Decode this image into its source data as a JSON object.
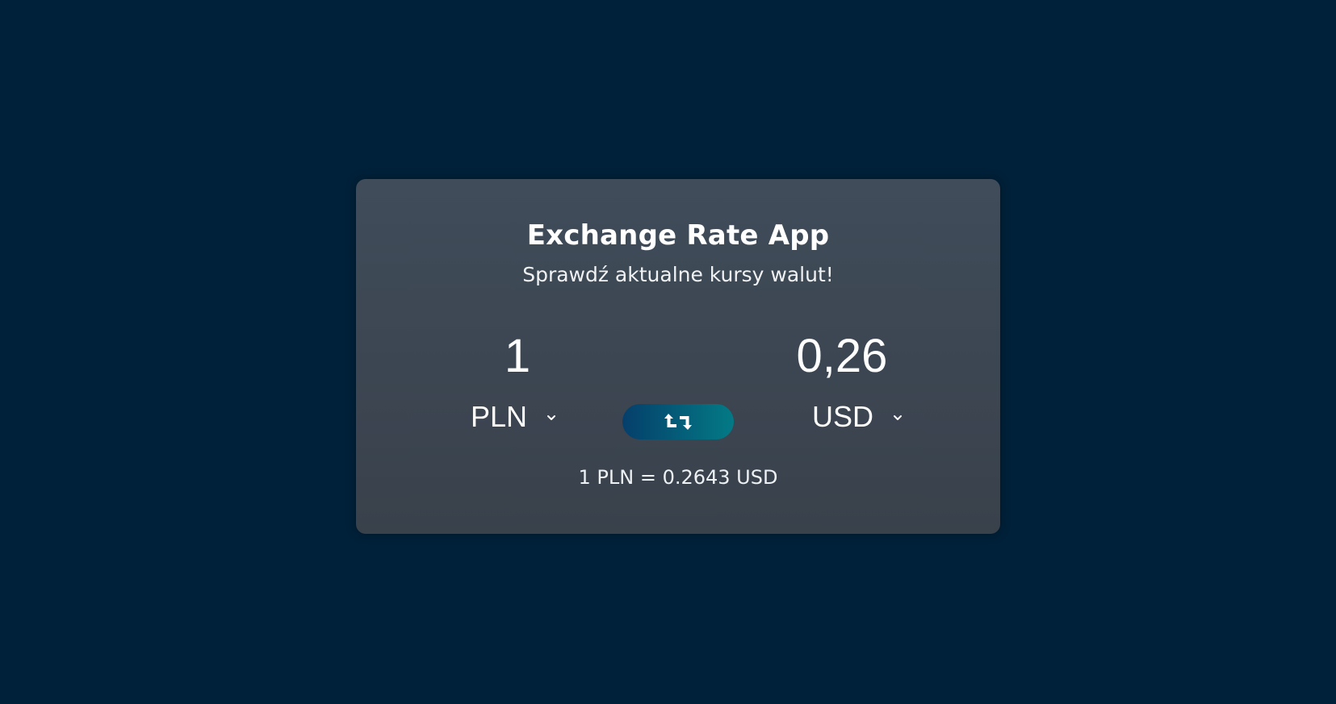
{
  "app": {
    "title": "Exchange Rate App",
    "subtitle": "Sprawdź aktualne kursy walut!"
  },
  "converter": {
    "from": {
      "amount": "1",
      "currency": "PLN"
    },
    "to": {
      "amount": "0,26",
      "currency": "USD"
    },
    "swap_icon": "swap-arrows-icon",
    "rate_text": "1 PLN = 0.2643 USD"
  },
  "colors": {
    "background": "#00213a",
    "card_top": "#404c5a",
    "card_bottom": "#39414b",
    "button_gradient_start": "#053f6b",
    "button_gradient_end": "#037a85",
    "text": "#ffffff"
  }
}
